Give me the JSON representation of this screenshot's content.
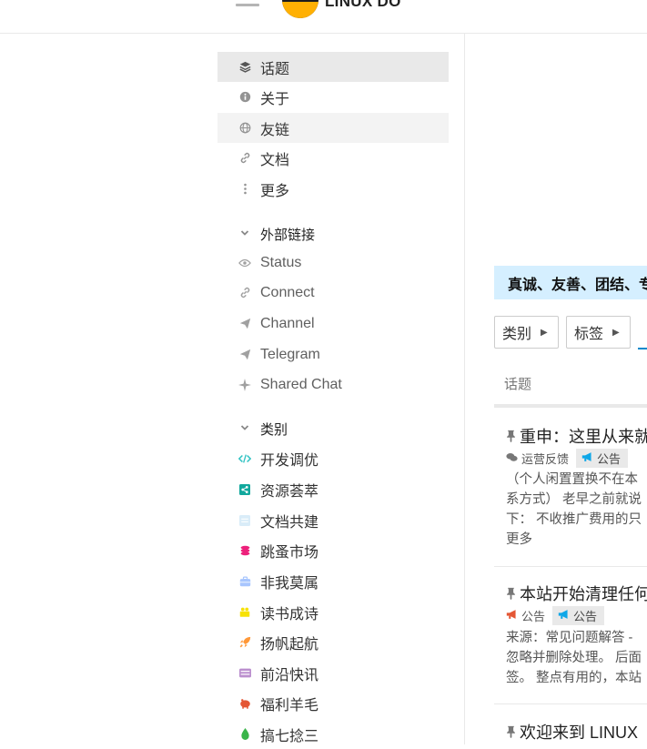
{
  "header": {
    "site_title": "LINUX DO"
  },
  "sidebar": {
    "items": [
      {
        "label": "话题",
        "icon": "layers-icon"
      },
      {
        "label": "关于",
        "icon": "info-icon"
      },
      {
        "label": "友链",
        "icon": "globe-icon"
      },
      {
        "label": "文档",
        "icon": "link-icon"
      },
      {
        "label": "更多",
        "icon": "ellipsis-vertical-icon"
      }
    ],
    "external_section": {
      "title": "外部链接",
      "items": [
        {
          "label": "Status",
          "icon": "eye-icon"
        },
        {
          "label": "Connect",
          "icon": "link-icon"
        },
        {
          "label": "Channel",
          "icon": "paper-plane-icon"
        },
        {
          "label": "Telegram",
          "icon": "paper-plane-icon"
        },
        {
          "label": "Shared Chat",
          "icon": "sparkle-icon"
        }
      ]
    },
    "category_section": {
      "title": "类别",
      "items": [
        {
          "label": "开发调优",
          "color": "#32c3c3"
        },
        {
          "label": "资源荟萃",
          "color": "#12a89d"
        },
        {
          "label": "文档共建",
          "color": "#bfe1f6"
        },
        {
          "label": "跳蚤市场",
          "color": "#ed207b"
        },
        {
          "label": "非我莫属",
          "color": "#a8c6fe"
        },
        {
          "label": "读书成诗",
          "color": "#f7f206"
        },
        {
          "label": "扬帆起航",
          "color": "#ff9838"
        },
        {
          "label": "前沿快讯",
          "color": "#bb8fce"
        },
        {
          "label": "福利羊毛",
          "color": "#e45735"
        },
        {
          "label": "搞七捻三",
          "color": "#3ab54a"
        }
      ]
    }
  },
  "main": {
    "banner_text": "真诚、友善、团结、专",
    "filters": {
      "category_label": "类别",
      "tag_label": "标签"
    },
    "column_header": "话题",
    "topics": [
      {
        "title": "重申：这里从来就",
        "category": "运营反馈",
        "tag": "公告",
        "excerpt_lines": [
          "（个人闲置置换不在本",
          "系方式） 老早之前就说",
          "下： 不收推广费用的只",
          "更多"
        ]
      },
      {
        "title": "本站开始清理任何",
        "category": "公告",
        "tag": "公告",
        "excerpt_lines": [
          "来源：常见问题解答 -",
          "忽略并删除处理。 后面",
          "签。 整点有用的，本站"
        ]
      },
      {
        "title": "欢迎来到 LINUX",
        "category": "",
        "tag": "",
        "excerpt_lines": []
      }
    ]
  }
}
